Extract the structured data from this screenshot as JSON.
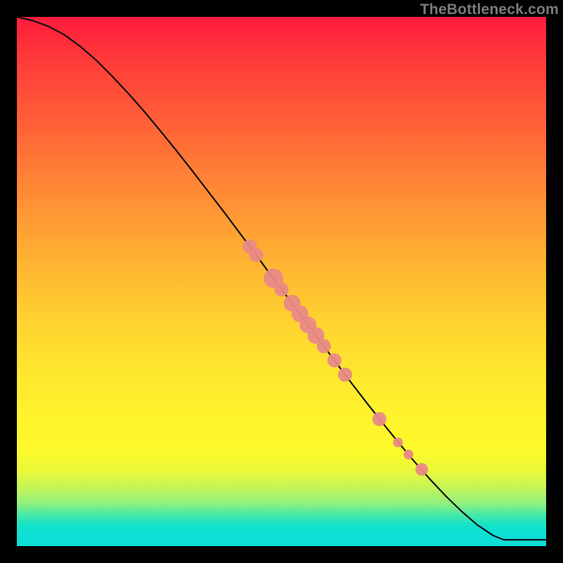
{
  "watermark": "TheBottleneck.com",
  "colors": {
    "curve_stroke": "#111111",
    "point_fill": "#e98a86",
    "point_stroke": "#d46e6a"
  },
  "chart_data": {
    "type": "line",
    "title": "",
    "xlabel": "",
    "ylabel": "",
    "xlim": [
      0,
      100
    ],
    "ylim": [
      0,
      100
    ],
    "grid": false,
    "series": [
      {
        "name": "curve",
        "x": [
          0,
          3,
          6,
          9,
          12,
          15,
          18,
          21,
          24,
          27,
          30,
          33,
          36,
          39,
          42,
          45,
          48,
          51,
          54,
          57,
          60,
          63,
          66,
          69,
          72,
          75,
          78,
          81,
          84,
          87,
          90,
          92,
          100
        ],
        "y": [
          100,
          99.3,
          98.2,
          96.6,
          94.4,
          91.8,
          88.8,
          85.6,
          82.2,
          78.6,
          74.9,
          71.1,
          67.2,
          63.3,
          59.3,
          55.3,
          51.2,
          47.2,
          43.1,
          39.1,
          35.1,
          31.1,
          27.2,
          23.4,
          19.7,
          16.1,
          12.7,
          9.5,
          6.6,
          4.0,
          2.0,
          1.2,
          1.2
        ]
      }
    ],
    "points": [
      {
        "x": 44.0,
        "y": 56.6,
        "r": 10
      },
      {
        "x": 45.2,
        "y": 55.0,
        "r": 10
      },
      {
        "x": 48.5,
        "y": 50.6,
        "r": 14
      },
      {
        "x": 50.0,
        "y": 48.5,
        "r": 10
      },
      {
        "x": 52.0,
        "y": 45.9,
        "r": 12
      },
      {
        "x": 53.5,
        "y": 43.9,
        "r": 12
      },
      {
        "x": 55.0,
        "y": 41.8,
        "r": 12
      },
      {
        "x": 56.5,
        "y": 39.8,
        "r": 12
      },
      {
        "x": 58.0,
        "y": 37.8,
        "r": 10
      },
      {
        "x": 60.0,
        "y": 35.1,
        "r": 10
      },
      {
        "x": 62.0,
        "y": 32.4,
        "r": 10
      },
      {
        "x": 68.5,
        "y": 24.0,
        "r": 10
      },
      {
        "x": 72.0,
        "y": 19.6,
        "r": 7
      },
      {
        "x": 74.0,
        "y": 17.3,
        "r": 7
      },
      {
        "x": 76.5,
        "y": 14.5,
        "r": 9
      }
    ]
  }
}
